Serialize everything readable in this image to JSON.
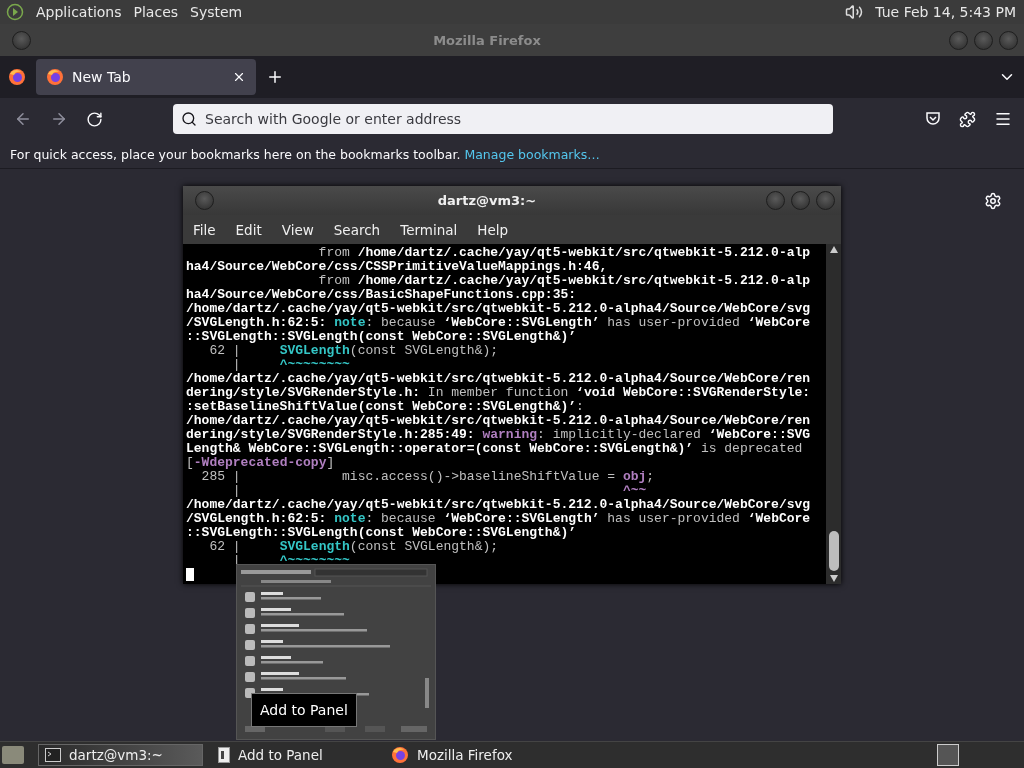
{
  "top_panel": {
    "menus": [
      "Applications",
      "Places",
      "System"
    ],
    "clock": "Tue Feb 14,  5:43 PM"
  },
  "browser": {
    "title": "Mozilla Firefox",
    "tabs": [
      {
        "label": "New Tab",
        "selected": true
      }
    ],
    "address": {
      "placeholder": "Search with Google or enter address"
    },
    "bookmarks_bar": {
      "message": "For quick access, place your bookmarks here on the bookmarks toolbar.",
      "link": "Manage bookmarks…"
    }
  },
  "terminal": {
    "title": "dartz@vm3:~",
    "menus": [
      "File",
      "Edit",
      "View",
      "Search",
      "Terminal",
      "Help"
    ],
    "lines": [
      [
        {
          "kind": "dim",
          "text": "                 from "
        },
        {
          "kind": "bold",
          "text": "/home/dartz/.cache/yay/qt5-webkit/src/qtwebkit-5.212.0-alp"
        }
      ],
      [
        {
          "kind": "bold",
          "text": "ha4/Source/WebCore/css/CSSPrimitiveValueMappings.h:46,"
        }
      ],
      [
        {
          "kind": "dim",
          "text": "                 from "
        },
        {
          "kind": "bold",
          "text": "/home/dartz/.cache/yay/qt5-webkit/src/qtwebkit-5.212.0-alp"
        }
      ],
      [
        {
          "kind": "bold",
          "text": "ha4/Source/WebCore/css/BasicShapeFunctions.cpp:35:"
        }
      ],
      [
        {
          "kind": "bold",
          "text": "/home/dartz/.cache/yay/qt5-webkit/src/qtwebkit-5.212.0-alpha4/Source/WebCore/svg"
        }
      ],
      [
        {
          "kind": "bold",
          "text": "/SVGLength.h:62:5: "
        },
        {
          "kind": "note",
          "text": "note"
        },
        {
          "kind": "dim",
          "text": ": because "
        },
        {
          "kind": "bold",
          "text": "‘WebCore::SVGLength’"
        },
        {
          "kind": "dim",
          "text": " has user-provided "
        },
        {
          "kind": "bold",
          "text": "‘WebCore"
        }
      ],
      [
        {
          "kind": "bold",
          "text": "::SVGLength::SVGLength(const WebCore::SVGLength&)’"
        }
      ],
      [
        {
          "kind": "dim",
          "text": "   62 |     "
        },
        {
          "kind": "note",
          "text": "SVGLength"
        },
        {
          "kind": "dim",
          "text": "(const SVGLength&);"
        }
      ],
      [
        {
          "kind": "dim",
          "text": "      |     "
        },
        {
          "kind": "note",
          "text": "^~~~~~~~~"
        }
      ],
      [
        {
          "kind": "bold",
          "text": "/home/dartz/.cache/yay/qt5-webkit/src/qtwebkit-5.212.0-alpha4/Source/WebCore/ren"
        }
      ],
      [
        {
          "kind": "bold",
          "text": "dering/style/SVGRenderStyle.h:"
        },
        {
          "kind": "dim",
          "text": " In member function "
        },
        {
          "kind": "bold",
          "text": "‘void WebCore::SVGRenderStyle:"
        }
      ],
      [
        {
          "kind": "bold",
          "text": ":setBaselineShiftValue(const WebCore::SVGLength&)’"
        },
        {
          "kind": "dim",
          "text": ":"
        }
      ],
      [
        {
          "kind": "bold",
          "text": "/home/dartz/.cache/yay/qt5-webkit/src/qtwebkit-5.212.0-alpha4/Source/WebCore/ren"
        }
      ],
      [
        {
          "kind": "bold",
          "text": "dering/style/SVGRenderStyle.h:285:49: "
        },
        {
          "kind": "warn",
          "text": "warning"
        },
        {
          "kind": "dim",
          "text": ": implicitly-declared "
        },
        {
          "kind": "bold",
          "text": "‘WebCore::SVG"
        }
      ],
      [
        {
          "kind": "bold",
          "text": "Length& WebCore::SVGLength::operator=(const WebCore::SVGLength&)’"
        },
        {
          "kind": "dim",
          "text": " is deprecated"
        }
      ],
      [
        {
          "kind": "dim",
          "text": "["
        },
        {
          "kind": "warn",
          "text": "-Wdeprecated-copy"
        },
        {
          "kind": "dim",
          "text": "]"
        }
      ],
      [
        {
          "kind": "dim",
          "text": "  285 |             misc.access()->baselineShiftValue = "
        },
        {
          "kind": "warn",
          "text": "obj"
        },
        {
          "kind": "dim",
          "text": ";"
        }
      ],
      [
        {
          "kind": "dim",
          "text": "      |                                                 "
        },
        {
          "kind": "warn",
          "text": "^~~"
        }
      ],
      [
        {
          "kind": "bold",
          "text": "/home/dartz/.cache/yay/qt5-webkit/src/qtwebkit-5.212.0-alpha4/Source/WebCore/svg"
        }
      ],
      [
        {
          "kind": "bold",
          "text": "/SVGLength.h:62:5: "
        },
        {
          "kind": "note",
          "text": "note"
        },
        {
          "kind": "dim",
          "text": ": because "
        },
        {
          "kind": "bold",
          "text": "‘WebCore::SVGLength’"
        },
        {
          "kind": "dim",
          "text": " has user-provided "
        },
        {
          "kind": "bold",
          "text": "‘WebCore"
        }
      ],
      [
        {
          "kind": "bold",
          "text": "::SVGLength::SVGLength(const WebCore::SVGLength&)’"
        }
      ],
      [
        {
          "kind": "dim",
          "text": "   62 |     "
        },
        {
          "kind": "note",
          "text": "SVGLength"
        },
        {
          "kind": "dim",
          "text": "(const SVGLength&);"
        }
      ],
      [
        {
          "kind": "dim",
          "text": "      |     "
        },
        {
          "kind": "note",
          "text": "^~~~~~~~~"
        }
      ]
    ]
  },
  "panel_preview": {
    "tooltip": "Add to Panel"
  },
  "taskbar": {
    "tasks": [
      {
        "kind": "terminal",
        "label": "dartz@vm3:~",
        "selected": true
      },
      {
        "kind": "dialog",
        "label": "Add to Panel",
        "selected": false
      },
      {
        "kind": "firefox",
        "label": "Mozilla Firefox",
        "selected": false
      }
    ]
  }
}
